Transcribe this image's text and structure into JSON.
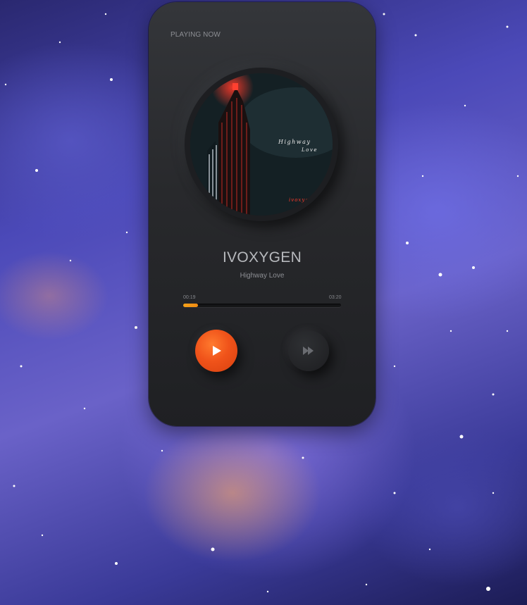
{
  "player": {
    "header_label": "PLAYING NOW",
    "artist": "IVOXYGEN",
    "song_title": "Highway Love",
    "current_time": "00:19",
    "duration": "03:20",
    "progress_fraction": 0.095,
    "accent_color": "#f0531a",
    "progress_color": "#f5a31a"
  },
  "album_art": {
    "title_line1": "Highway",
    "title_line2": "Love",
    "artist_tag": "ivoxyg"
  },
  "controls": {
    "play_icon": "play-icon",
    "next_icon": "fast-forward-icon"
  },
  "background": {
    "description": "space-nebula"
  }
}
